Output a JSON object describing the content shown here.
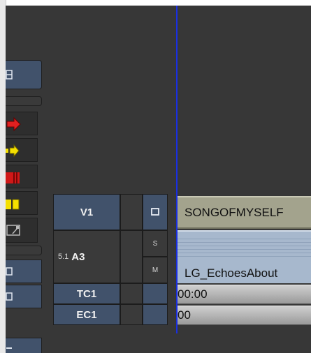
{
  "timeline": {
    "tracks": [
      {
        "id": "v1",
        "label": "V1",
        "toggle_glyph": "square-icon"
      },
      {
        "id": "a3",
        "prefix": "5.1",
        "label": "A3",
        "solo": "S",
        "mute": "M"
      },
      {
        "id": "tc1",
        "label": "TC1"
      },
      {
        "id": "ec1",
        "label": "EC1"
      }
    ],
    "clips": {
      "video_clip_name": "SONGOFMYSELF",
      "audio_clip_name": "LG_EchoesAbout",
      "tc_readout": "00:00",
      "ec_readout": "00"
    }
  },
  "palette": {
    "tools": [
      "grid-icon",
      "red-arrow-icon",
      "yellow-arrow-icon",
      "red-clip-icon",
      "yellow-clip-icon",
      "trim-icon",
      "square-icon",
      "square-icon",
      "square-icon"
    ]
  },
  "colors": {
    "background": "#373737",
    "track_button": "#41526b",
    "video_clip": "#a3a38d",
    "audio_clip": "#a7b8cd",
    "playhead": "#1a2fe0"
  }
}
